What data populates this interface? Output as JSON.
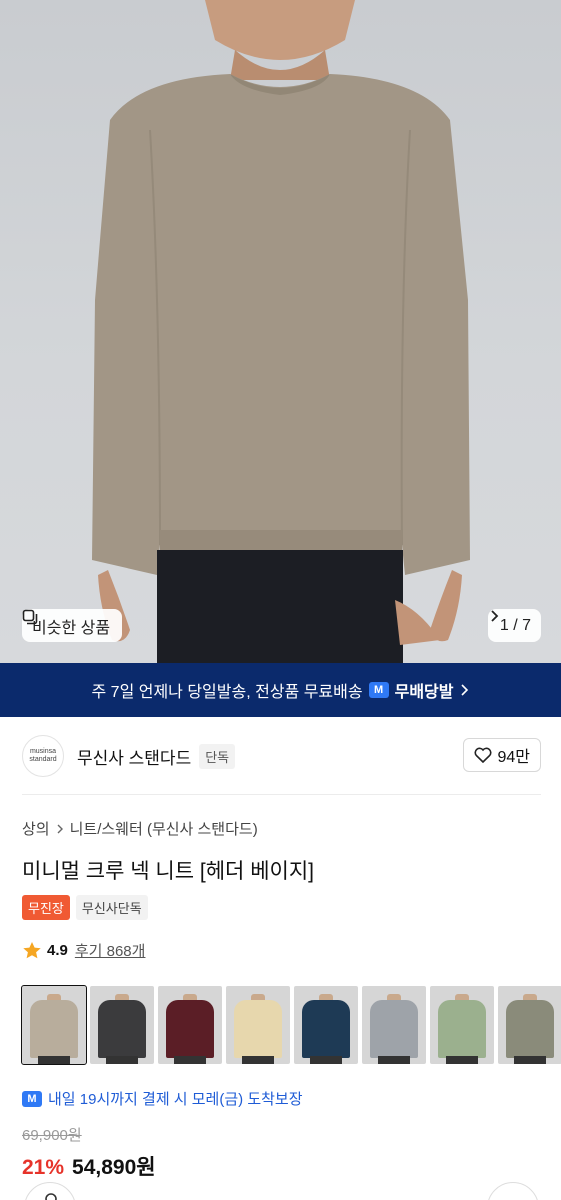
{
  "hero": {
    "similar_label": "비슷한 상품",
    "counter": "1 / 7",
    "chevron": "chevron-right-icon"
  },
  "banner": {
    "text": "주 7일 언제나 당일발송, 전상품 무료배송",
    "logo_letter": "M",
    "service": "무배당발"
  },
  "brand": {
    "logo_line1": "musinsa",
    "logo_line2": "standard",
    "name": "무신사 스탠다드",
    "tag": "단독",
    "likes": "94만"
  },
  "breadcrumb": {
    "level1": "상의",
    "level2": "니트/스웨터 (무신사 스탠다드)"
  },
  "product": {
    "title": "미니멀 크루 넥 니트 [헤더 베이지]",
    "badge_primary": "무진장",
    "badge_secondary": "무신사단독",
    "rating": "4.9",
    "reviews": "후기 868개"
  },
  "swatches": [
    {
      "name": "beige",
      "color": "#b8ad9c",
      "selected": true
    },
    {
      "name": "charcoal",
      "color": "#3b3b3d"
    },
    {
      "name": "burgundy",
      "color": "#5b1e26"
    },
    {
      "name": "cream",
      "color": "#e7d7ad"
    },
    {
      "name": "navy",
      "color": "#1e3a55"
    },
    {
      "name": "gray",
      "color": "#9ea3a9"
    },
    {
      "name": "sage",
      "color": "#9bb08e"
    },
    {
      "name": "olive",
      "color": "#8a8b7a"
    }
  ],
  "shipping": {
    "logo_letter": "M",
    "text": "내일 19시까지 결제 시 모레(금) 도착보장"
  },
  "price": {
    "original": "69,900원",
    "discount": "21%",
    "final": "54,890원"
  },
  "colors": {
    "banner_bg": "#0b2a6c",
    "accent_blue": "#2f79f5",
    "discount_red": "#e6332a",
    "badge_orange": "#f05a33"
  }
}
